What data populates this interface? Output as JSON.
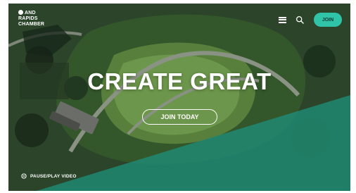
{
  "header": {
    "logo_line1": "AND",
    "logo_line2": "RAPIDS",
    "logo_line3": "CHAMBER",
    "join_label": "JOIN",
    "icons": [
      "menu-icon",
      "search-icon"
    ]
  },
  "hero": {
    "headline": "CREATE GREAT",
    "cta_label": "JOIN TODAY",
    "video_toggle_label": "PAUSE/PLAY VIDEO"
  },
  "colors": {
    "accent": "#2fc3a8",
    "teal_overlay": "#1f8a72",
    "text": "#ffffff"
  }
}
